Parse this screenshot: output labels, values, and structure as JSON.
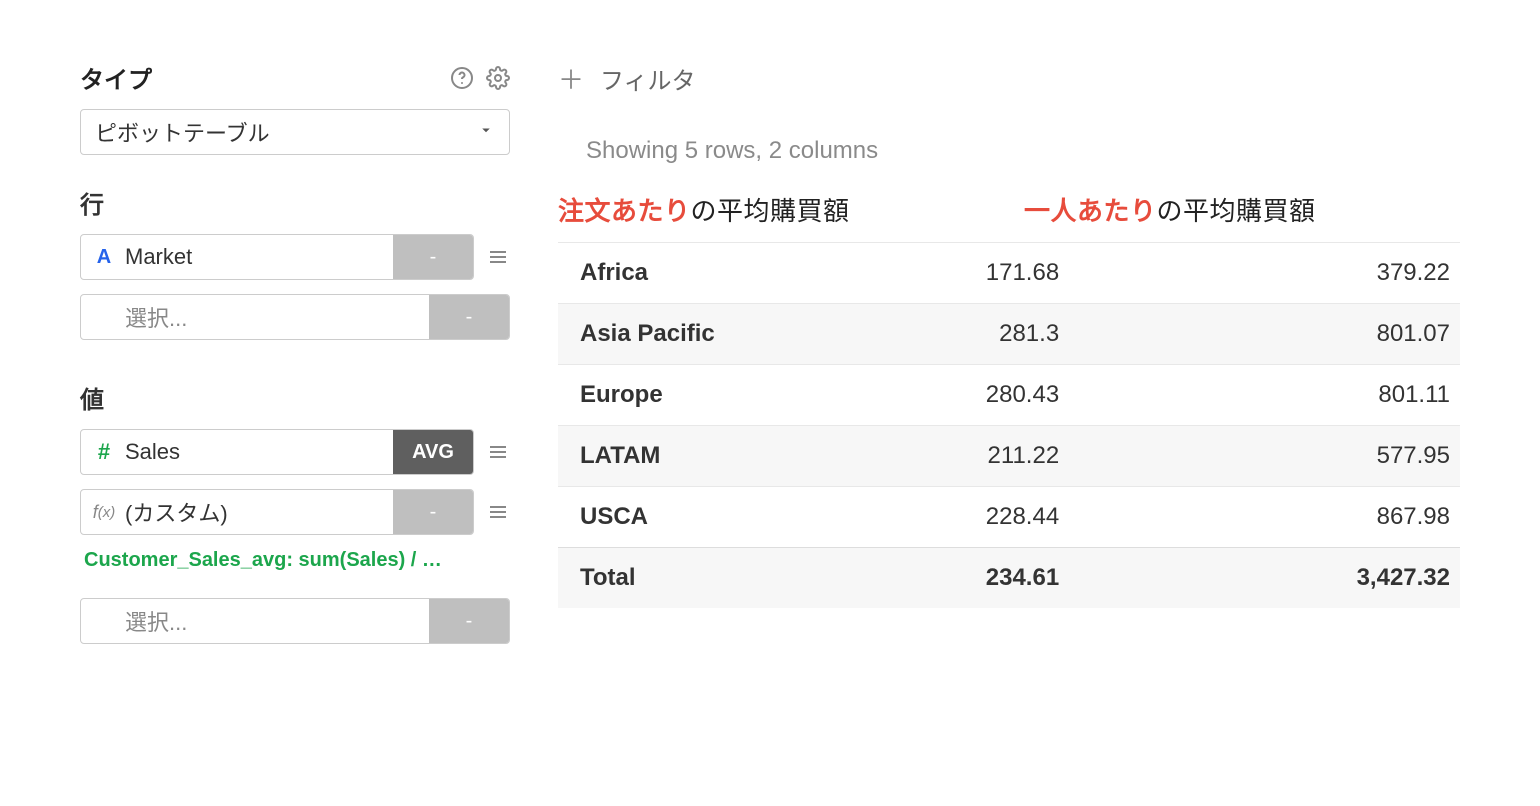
{
  "sidebar": {
    "type_label": "タイプ",
    "type_value": "ピボットテーブル",
    "rows_label": "行",
    "row_fields": [
      {
        "icon": "text",
        "name": "Market",
        "agg": "-",
        "agg_style": "light",
        "drag": true
      },
      {
        "icon": "",
        "name": "選択...",
        "agg": "-",
        "agg_style": "light",
        "drag": false,
        "placeholder": true
      }
    ],
    "values_label": "値",
    "value_fields": [
      {
        "icon": "num",
        "name": "Sales",
        "agg": "AVG",
        "agg_style": "dark",
        "drag": true
      },
      {
        "icon": "fx",
        "name": "(カスタム)",
        "agg": "-",
        "agg_style": "light",
        "drag": true,
        "formula": "Customer_Sales_avg: sum(Sales) / …"
      },
      {
        "icon": "",
        "name": "選択...",
        "agg": "-",
        "agg_style": "light",
        "drag": false,
        "placeholder": true
      }
    ]
  },
  "main": {
    "filter_label": "フィルタ",
    "showing_text": "Showing 5 rows, 2 columns",
    "col1_highlight": "注文あたり",
    "col1_rest": "の平均購買額",
    "col2_highlight": "一人あたり",
    "col2_rest": "の平均購買額",
    "rows": [
      {
        "name": "Africa",
        "v1": "171.68",
        "v2": "379.22"
      },
      {
        "name": "Asia Pacific",
        "v1": "281.3",
        "v2": "801.07"
      },
      {
        "name": "Europe",
        "v1": "280.43",
        "v2": "801.11"
      },
      {
        "name": "LATAM",
        "v1": "211.22",
        "v2": "577.95"
      },
      {
        "name": "USCA",
        "v1": "228.44",
        "v2": "867.98"
      }
    ],
    "total": {
      "name": "Total",
      "v1": "234.61",
      "v2": "3,427.32"
    }
  },
  "chart_data": {
    "type": "table",
    "title": "Pivot: 注文あたり / 一人あたり の平均購買額 by Market",
    "columns": [
      "Market",
      "注文あたりの平均購買額",
      "一人あたりの平均購買額"
    ],
    "rows": [
      [
        "Africa",
        171.68,
        379.22
      ],
      [
        "Asia Pacific",
        281.3,
        801.07
      ],
      [
        "Europe",
        280.43,
        801.11
      ],
      [
        "LATAM",
        211.22,
        577.95
      ],
      [
        "USCA",
        228.44,
        867.98
      ]
    ],
    "totals": [
      "Total",
      234.61,
      3427.32
    ]
  }
}
